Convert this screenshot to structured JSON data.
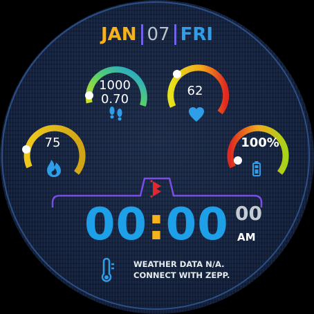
{
  "date": {
    "month": "JAN",
    "day": "07",
    "weekday": "FRI"
  },
  "widgets": {
    "steps": {
      "value": "1000",
      "distance": "0.70",
      "icon": "footsteps-icon"
    },
    "heart_rate": {
      "value": "62",
      "icon": "heart-icon"
    },
    "calories": {
      "value": "75",
      "icon": "flame-icon"
    },
    "battery": {
      "value": "100%",
      "icon": "battery-icon"
    }
  },
  "time": {
    "hours": "00",
    "separator": ":",
    "minutes": "00",
    "seconds": "00",
    "ampm": "AM"
  },
  "weather": {
    "line1": "WEATHER DATA N/A.",
    "line2": "CONNECT WITH ZEPP.",
    "icon": "thermometer-icon"
  },
  "colors": {
    "accent_blue": "#1ea0e8",
    "accent_yellow": "#f5b21c",
    "accent_purple": "#6f63e6",
    "alarm_red": "#e0282e"
  }
}
